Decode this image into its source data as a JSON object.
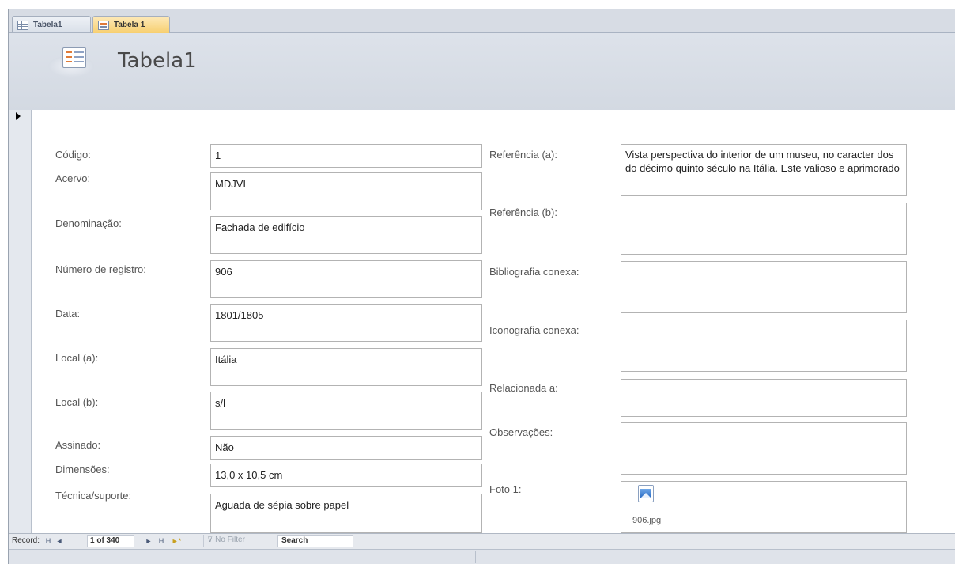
{
  "tabs": [
    {
      "label": "Tabela1",
      "icon": "table-grid-icon"
    },
    {
      "label": "Tabela 1",
      "icon": "form-icon"
    }
  ],
  "header": {
    "title": "Tabela1",
    "logo_icon": "form-icon"
  },
  "left_fields": [
    {
      "label": "Código:",
      "value": "1"
    },
    {
      "label": "Acervo:",
      "value": "MDJVI"
    },
    {
      "label": "Denominação:",
      "value": "Fachada de edifício"
    },
    {
      "label": "Número de registro:",
      "value": "906"
    },
    {
      "label": "Data:",
      "value": "1801/1805"
    },
    {
      "label": "Local (a):",
      "value": "Itália"
    },
    {
      "label": "Local (b):",
      "value": "s/l"
    },
    {
      "label": "Assinado:",
      "value": "Não"
    },
    {
      "label": "Dimensões:",
      "value": "13,0 x 10,5 cm"
    },
    {
      "label": "Técnica/suporte:",
      "value": "Aguada de sépia sobre papel"
    }
  ],
  "right_fields": [
    {
      "label": "Referência (a):",
      "value": "Vista perspectiva do interior de um museu, no caracter dos do décimo quinto século na Itália. Este valioso e aprimorado"
    },
    {
      "label": "Referência (b):",
      "value": ""
    },
    {
      "label": "Bibliografia conexa:",
      "value": ""
    },
    {
      "label": "Iconografia conexa:",
      "value": ""
    },
    {
      "label": "Relacionada a:",
      "value": ""
    },
    {
      "label": "Observações:",
      "value": ""
    },
    {
      "label": "Foto 1:",
      "value": ""
    }
  ],
  "photo": {
    "filename": "906.jpg",
    "icon": "image-file-icon"
  },
  "navigation": {
    "record_label": "Record:",
    "first": "H",
    "prev": "◄",
    "counter": "1 of 340",
    "next": "►",
    "last": "H",
    "new": "►*",
    "filter_label": "No Filter",
    "search_label": "Search"
  }
}
